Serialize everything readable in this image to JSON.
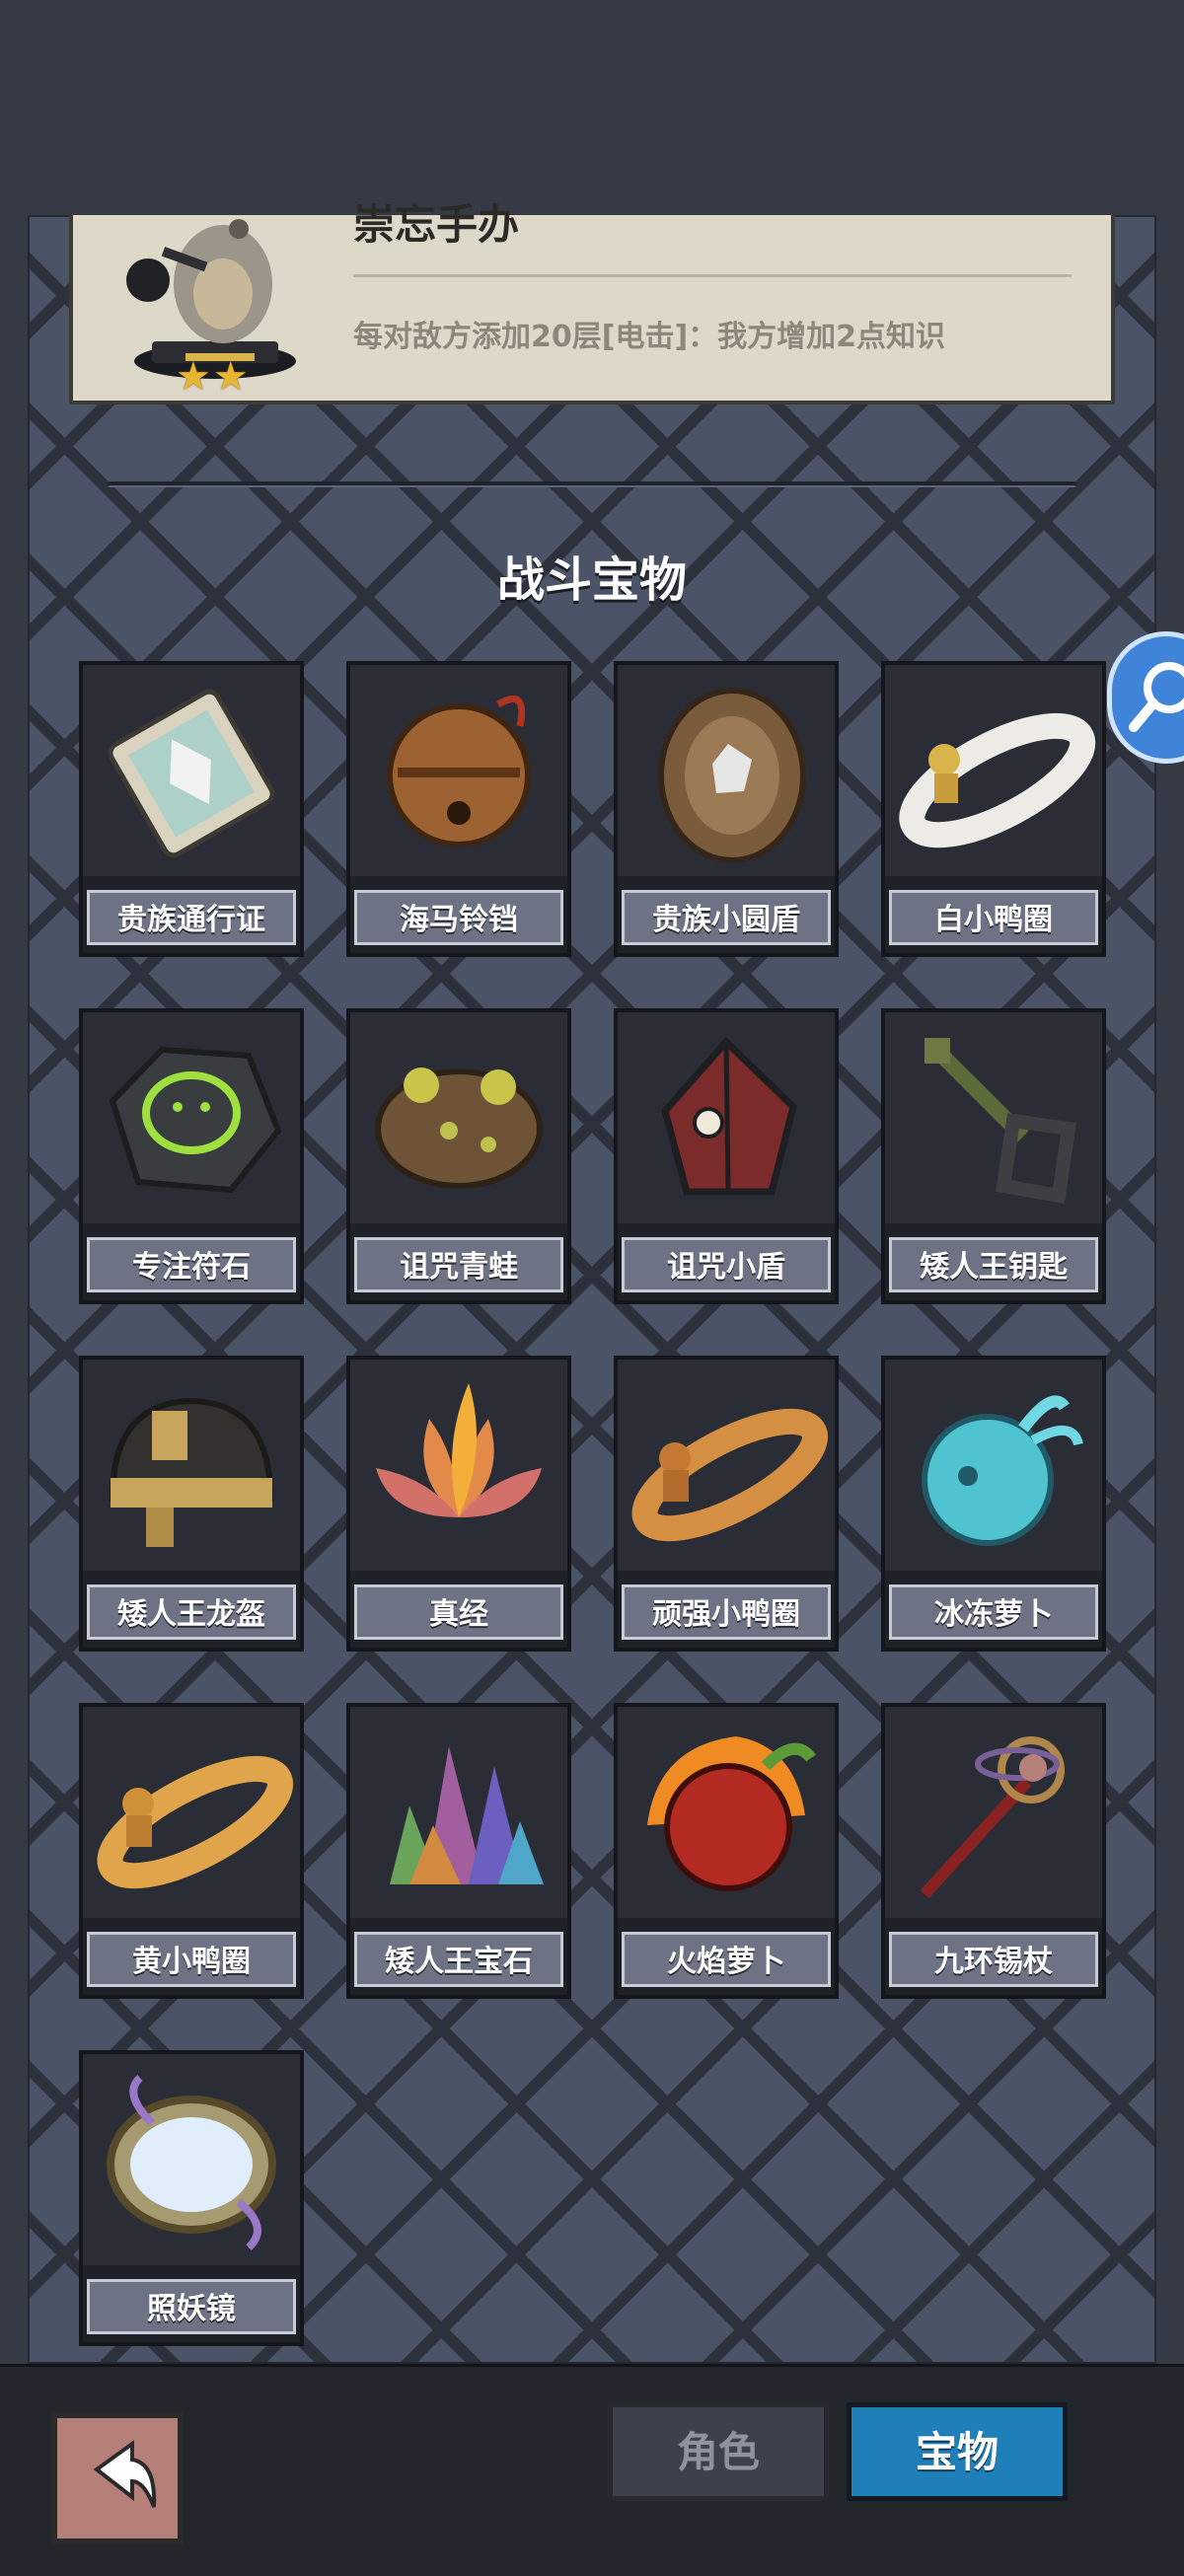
{
  "hero_card": {
    "title": "崇忘手办",
    "description": "每对敌方添加20层[电击]：我方增加2点知识",
    "stars": [
      "★",
      "★"
    ]
  },
  "section": {
    "title": "战斗宝物"
  },
  "items": [
    {
      "name": "贵族通行证",
      "icon": "card-pass-icon"
    },
    {
      "name": "海马铃铛",
      "icon": "bell-icon"
    },
    {
      "name": "贵族小圆盾",
      "icon": "round-shield-icon"
    },
    {
      "name": "白小鸭圈",
      "icon": "white-duck-ring-icon"
    },
    {
      "name": "专注符石",
      "icon": "rune-stone-icon"
    },
    {
      "name": "诅咒青蛙",
      "icon": "frog-icon"
    },
    {
      "name": "诅咒小盾",
      "icon": "cursed-shield-icon"
    },
    {
      "name": "矮人王钥匙",
      "icon": "key-icon"
    },
    {
      "name": "矮人王龙盔",
      "icon": "helmet-icon"
    },
    {
      "name": "真经",
      "icon": "lotus-icon"
    },
    {
      "name": "顽强小鸭圈",
      "icon": "orange-duck-ring-icon"
    },
    {
      "name": "冰冻萝卜",
      "icon": "ice-radish-icon"
    },
    {
      "name": "黄小鸭圈",
      "icon": "yellow-duck-ring-icon"
    },
    {
      "name": "矮人王宝石",
      "icon": "crystal-icon"
    },
    {
      "name": "火焰萝卜",
      "icon": "fire-radish-icon"
    },
    {
      "name": "九环锡杖",
      "icon": "staff-icon"
    },
    {
      "name": "照妖镜",
      "icon": "mirror-icon"
    }
  ],
  "bottom_bar": {
    "back_icon": "back-arrow-icon",
    "tabs": [
      {
        "label": "角色",
        "active": false
      },
      {
        "label": "宝物",
        "active": true
      }
    ]
  },
  "colors": {
    "panel": "#4b5366",
    "star": "#e8b630",
    "active_tab": "#1f7fb8",
    "float_button": "#3f84d8"
  }
}
